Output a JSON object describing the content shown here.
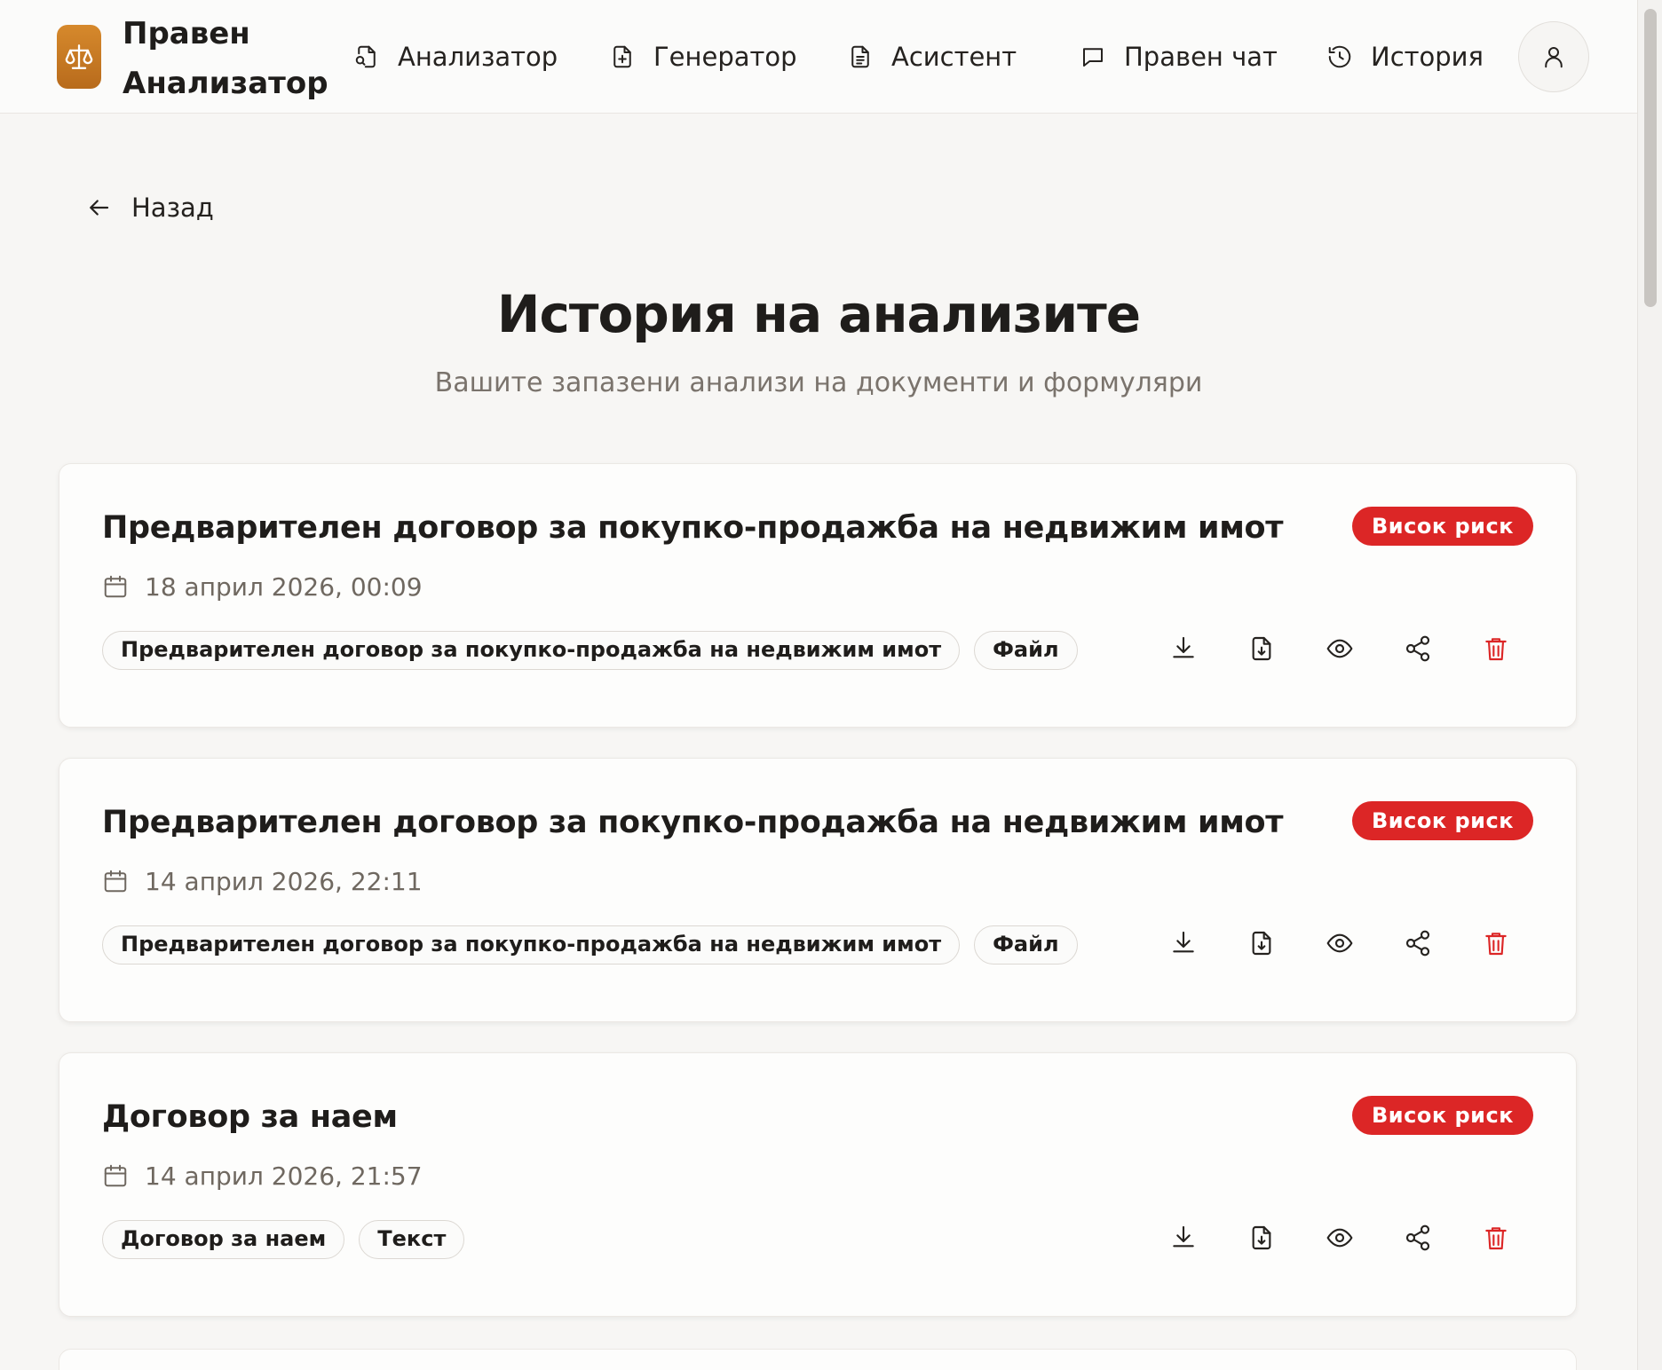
{
  "brand": {
    "name_line1": "Правен",
    "name_line2": "Анализатор",
    "accent": "#c97a24"
  },
  "nav": {
    "items": [
      {
        "label": "Анализатор",
        "icon": "file-search-icon"
      },
      {
        "label": "Генератор",
        "icon": "file-plus-icon"
      },
      {
        "label": "Асистент",
        "icon": "file-text-icon"
      },
      {
        "label": "Правен чат",
        "icon": "chat-icon"
      },
      {
        "label": "История",
        "icon": "history-icon"
      }
    ],
    "profile_icon": "user-icon"
  },
  "back_label": "Назад",
  "page": {
    "title": "История на анализите",
    "subtitle": "Вашите запазени анализи на документи и формуляри"
  },
  "colors": {
    "risk_high": "#dc2626",
    "delete": "#dc2626"
  },
  "analyses": [
    {
      "title": "Предварителен договор за покупко-продажба на недвижим имот",
      "risk": "Висок риск",
      "date": "18 април 2026, 00:09",
      "tags": [
        "Предварителен договор за покупко-продажба на недвижим имот",
        "Файл"
      ]
    },
    {
      "title": "Предварителен договор за покупко-продажба на недвижим имот",
      "risk": "Висок риск",
      "date": "14 април 2026, 22:11",
      "tags": [
        "Предварителен договор за покупко-продажба на недвижим имот",
        "Файл"
      ]
    },
    {
      "title": "Договор за наем",
      "risk": "Висок риск",
      "date": "14 април 2026, 21:57",
      "tags": [
        "Договор за наем",
        "Текст"
      ]
    }
  ]
}
